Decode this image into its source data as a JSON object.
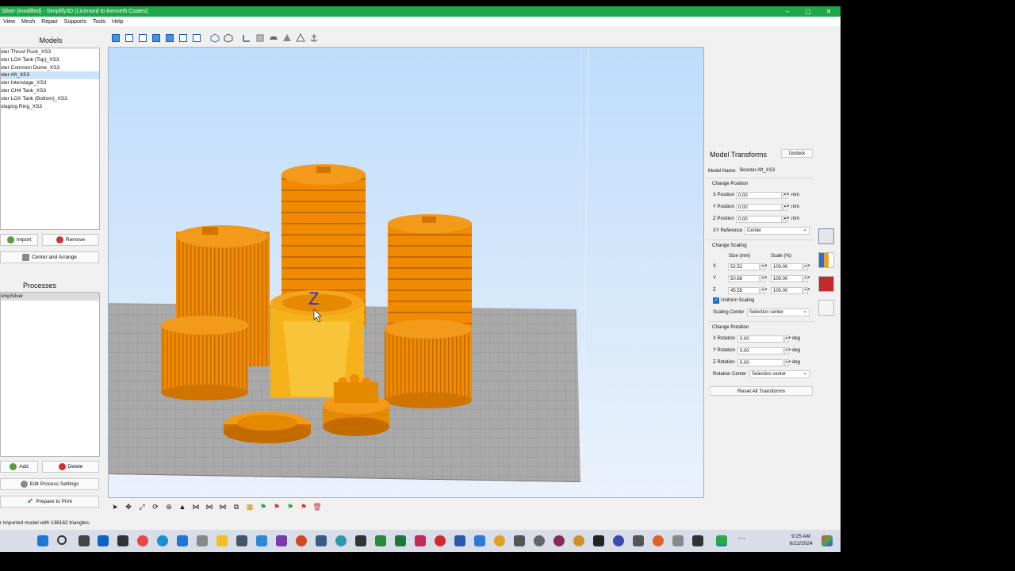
{
  "window": {
    "title": "Silver (modified) - Simplify3D (Licensed to Kenneth Coates)",
    "controls": [
      "–",
      "▢",
      "✕"
    ]
  },
  "menu": [
    "View",
    "Mesh",
    "Repair",
    "Supports",
    "Tools",
    "Help"
  ],
  "models": {
    "title": "Models",
    "items": [
      "ster Thrust Puck_XS3",
      "ster LOX Tank (Top)_XS3",
      "ster Common Dome_XS3",
      "ster Aft_XS3",
      "ster Interstage_XS3",
      "ster CH4 Tank_XS3",
      "ster LOX Tank (Bottom)_XS3",
      "staging Ring_XS3"
    ],
    "selected_index": 3,
    "import_label": "Import",
    "remove_label": "Remove",
    "center_label": "Center and Arrange"
  },
  "processes": {
    "title": "Processes",
    "items": [
      "shipSilver"
    ],
    "add_label": "Add",
    "delete_label": "Delete",
    "edit_label": "Edit Process Settings",
    "prepare_label": "Prepare to Print"
  },
  "status_text": "r imported model with 138162 triangles.",
  "viewport": {
    "axis_label": "Z",
    "sky_color": "#bfdcfb",
    "model_color": "#f08a00",
    "floor_color": "#a9a9a9"
  },
  "transforms": {
    "title": "Model Transforms",
    "undock_label": "Undock",
    "model_name_label": "Model Name:",
    "model_name": "Booster Aft_XS3",
    "change_position": "Change Position",
    "x_pos_label": "X Position",
    "x_pos": "0.00",
    "y_pos_label": "Y Position",
    "y_pos": "0.00",
    "z_pos_label": "Z Position",
    "z_pos": "0.00",
    "unit_mm": "mm",
    "xy_ref_label": "XY Reference",
    "xy_ref": "Center",
    "change_scaling": "Change Scaling",
    "size_header": "Size (mm)",
    "scale_header": "Scale (%)",
    "x_label": "X",
    "y_label": "Y",
    "z_label": "Z",
    "size_x": "52.52",
    "size_y": "50.68",
    "size_z": "45.55",
    "scale_x": "100.00",
    "scale_y": "100.00",
    "scale_z": "100.00",
    "uniform_label": "Uniform Scaling",
    "scaling_center_label": "Scaling Center",
    "scaling_center": "Selection center",
    "change_rotation": "Change Rotation",
    "x_rot_label": "X Rotation",
    "x_rot": "0.00",
    "y_rot_label": "Y Rotation",
    "y_rot": "0.00",
    "z_rot_label": "Z Rotation",
    "z_rot": "0.00",
    "unit_deg": "deg",
    "rot_center_label": "Rotation Center",
    "rot_center": "Selection center",
    "reset_label": "Reset All Transforms"
  },
  "taskbar": {
    "time": "9:25 AM",
    "date": "6/22/2024"
  }
}
